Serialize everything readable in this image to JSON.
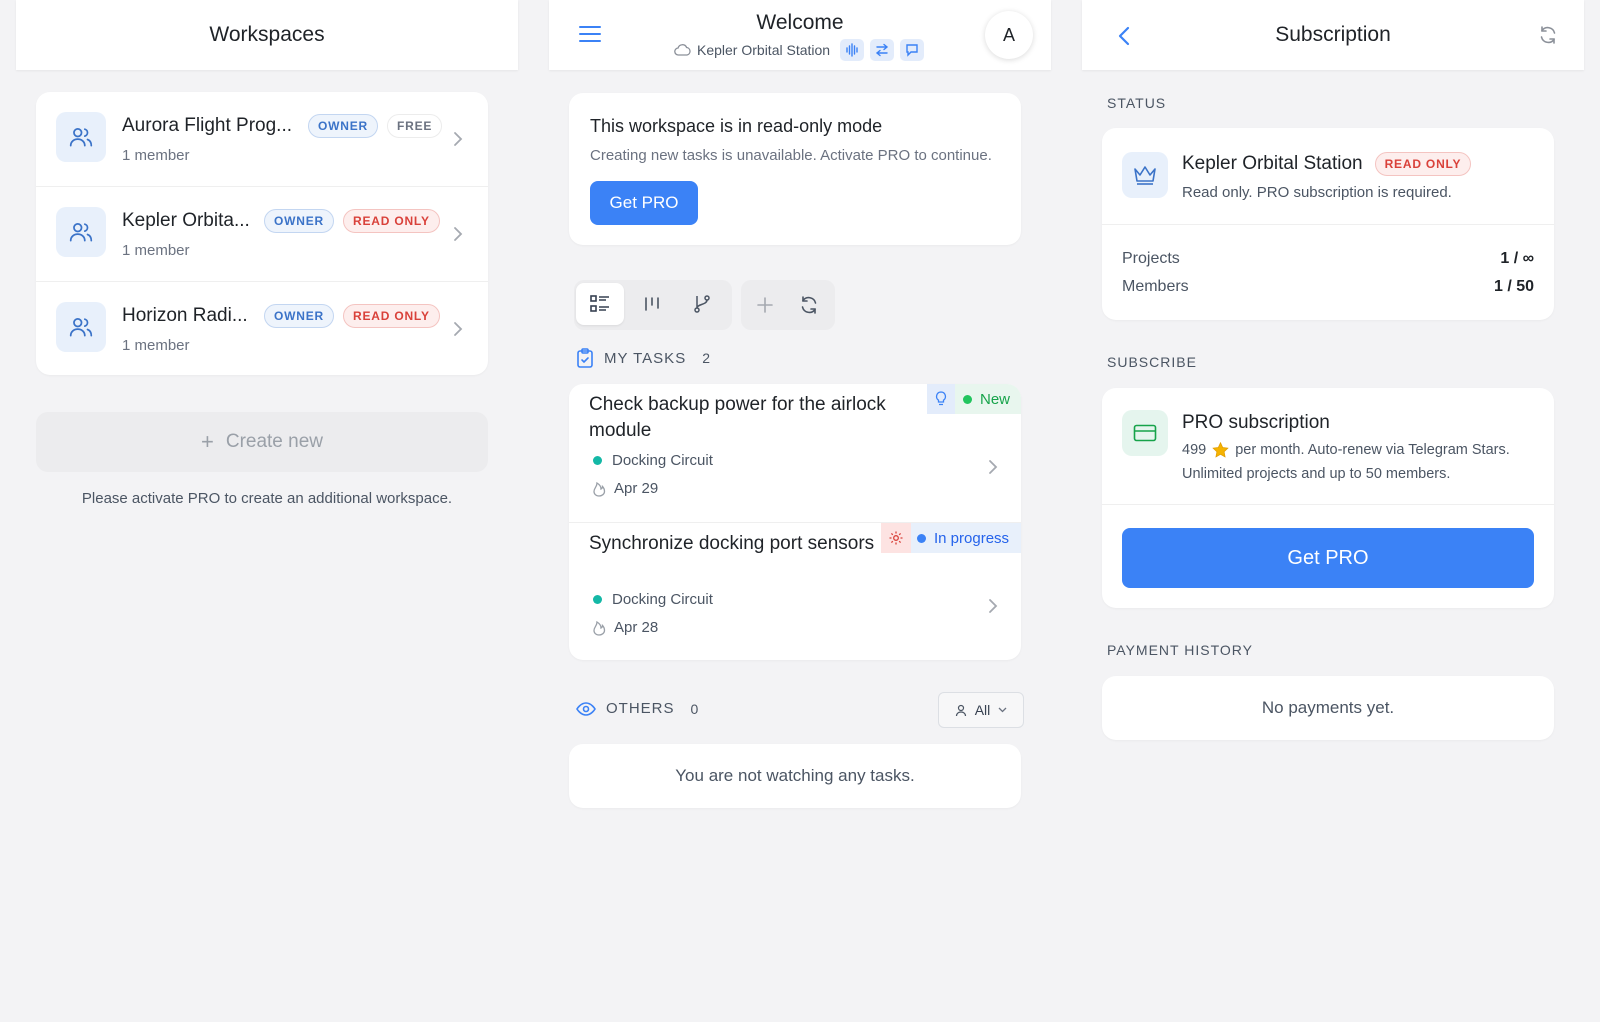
{
  "workspaces_panel": {
    "title": "Workspaces",
    "items": [
      {
        "name": "Aurora Flight Prog...",
        "members": "1 member",
        "role_badge": "OWNER",
        "plan_badge": "FREE"
      },
      {
        "name": "Kepler Orbita...",
        "members": "1 member",
        "role_badge": "OWNER",
        "plan_badge": "READ ONLY"
      },
      {
        "name": "Horizon Radi...",
        "members": "1 member",
        "role_badge": "OWNER",
        "plan_badge": "READ ONLY"
      }
    ],
    "create_new_label": "Create new",
    "create_plus": "+",
    "pro_notice": "Please activate PRO to create an additional workspace."
  },
  "welcome_panel": {
    "title": "Welcome",
    "workspace_name": "Kepler Orbital Station",
    "avatar_letter": "A",
    "readonly_card": {
      "heading": "This workspace is in read-only mode",
      "body": "Creating new tasks is unavailable. Activate PRO to continue.",
      "button": "Get PRO"
    },
    "my_tasks": {
      "label": "MY TASKS",
      "count": "2",
      "tasks": [
        {
          "title": "Check backup power for the airlock module",
          "project": "Docking Circuit",
          "date": "Apr 29",
          "status": "New"
        },
        {
          "title": "Synchronize docking port sensors",
          "project": "Docking Circuit",
          "date": "Apr 28",
          "status": "In progress"
        }
      ]
    },
    "others": {
      "label": "OTHERS",
      "count": "0",
      "filter": "All",
      "empty": "You are not watching any tasks."
    }
  },
  "subscription_panel": {
    "title": "Subscription",
    "status_label": "STATUS",
    "status_card": {
      "name": "Kepler Orbital Station",
      "badge": "READ ONLY",
      "description": "Read only. PRO subscription is required.",
      "projects_label": "Projects",
      "projects_value": "1 / ∞",
      "members_label": "Members",
      "members_value": "1 / 50"
    },
    "subscribe_label": "SUBSCRIBE",
    "subscribe_card": {
      "title": "PRO subscription",
      "price": "499",
      "line1_rest": "per month. Auto-renew via Telegram Stars.",
      "line2": "Unlimited projects and up to 50 members.",
      "button": "Get PRO"
    },
    "history_label": "PAYMENT HISTORY",
    "history_empty": "No payments yet."
  },
  "colors": {
    "accent": "#3b82f6",
    "badge_red": "#d9413a",
    "badge_blue": "#3b73c8",
    "status_new": "#22c55e",
    "status_progress": "#3b82f6",
    "project_dot": "#14b8a6"
  }
}
